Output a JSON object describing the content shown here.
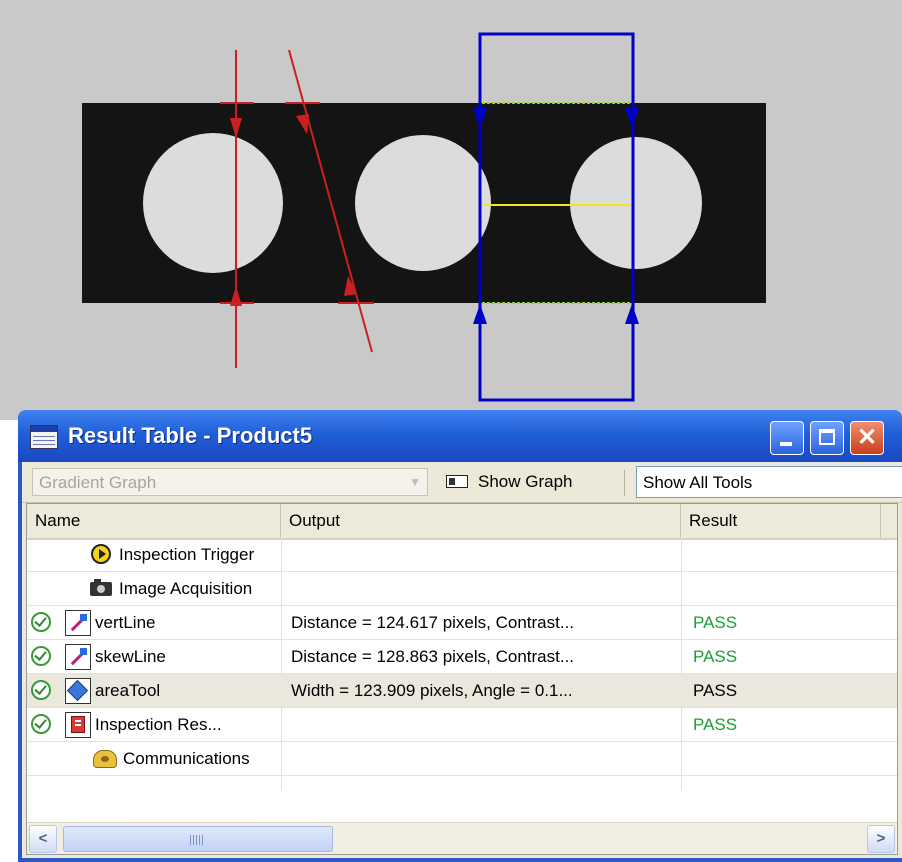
{
  "window": {
    "title": "Result Table - Product5"
  },
  "toolbar": {
    "graph_select": "Gradient Graph",
    "show_graph_label": "Show Graph",
    "filter_select": "Show All Tools"
  },
  "table": {
    "columns": [
      "Name",
      "Output",
      "Result"
    ],
    "rows": [
      {
        "name": "Inspection Trigger",
        "output": "",
        "result": "",
        "icon": "trigger-icon",
        "status": ""
      },
      {
        "name": "Image Acquisition",
        "output": "",
        "result": "",
        "icon": "camera-icon",
        "status": ""
      },
      {
        "name": "vertLine",
        "output": "Distance = 124.617 pixels, Contrast...",
        "result": "PASS",
        "icon": "line-tool-icon",
        "status": "pass-check-icon"
      },
      {
        "name": "skewLine",
        "output": "Distance = 128.863 pixels, Contrast...",
        "result": "PASS",
        "icon": "line-tool-icon",
        "status": "pass-check-icon"
      },
      {
        "name": "areaTool",
        "output": "Width = 123.909 pixels, Angle = 0.1...",
        "result": "PASS",
        "icon": "area-tool-icon",
        "status": "pass-check-icon",
        "selected": true
      },
      {
        "name": "Inspection Res...",
        "output": "",
        "result": "PASS",
        "icon": "inspection-result-icon",
        "status": "pass-check-icon"
      },
      {
        "name": "Communications",
        "output": "",
        "result": "",
        "icon": "communications-icon",
        "status": ""
      }
    ]
  },
  "colors": {
    "pass": "#19a030",
    "titlebar": "#215fd8",
    "tool_red": "#cc2020",
    "tool_blue": "#0000c8",
    "edge_green": "#9ad23a",
    "measure_yellow": "#f2e619"
  }
}
